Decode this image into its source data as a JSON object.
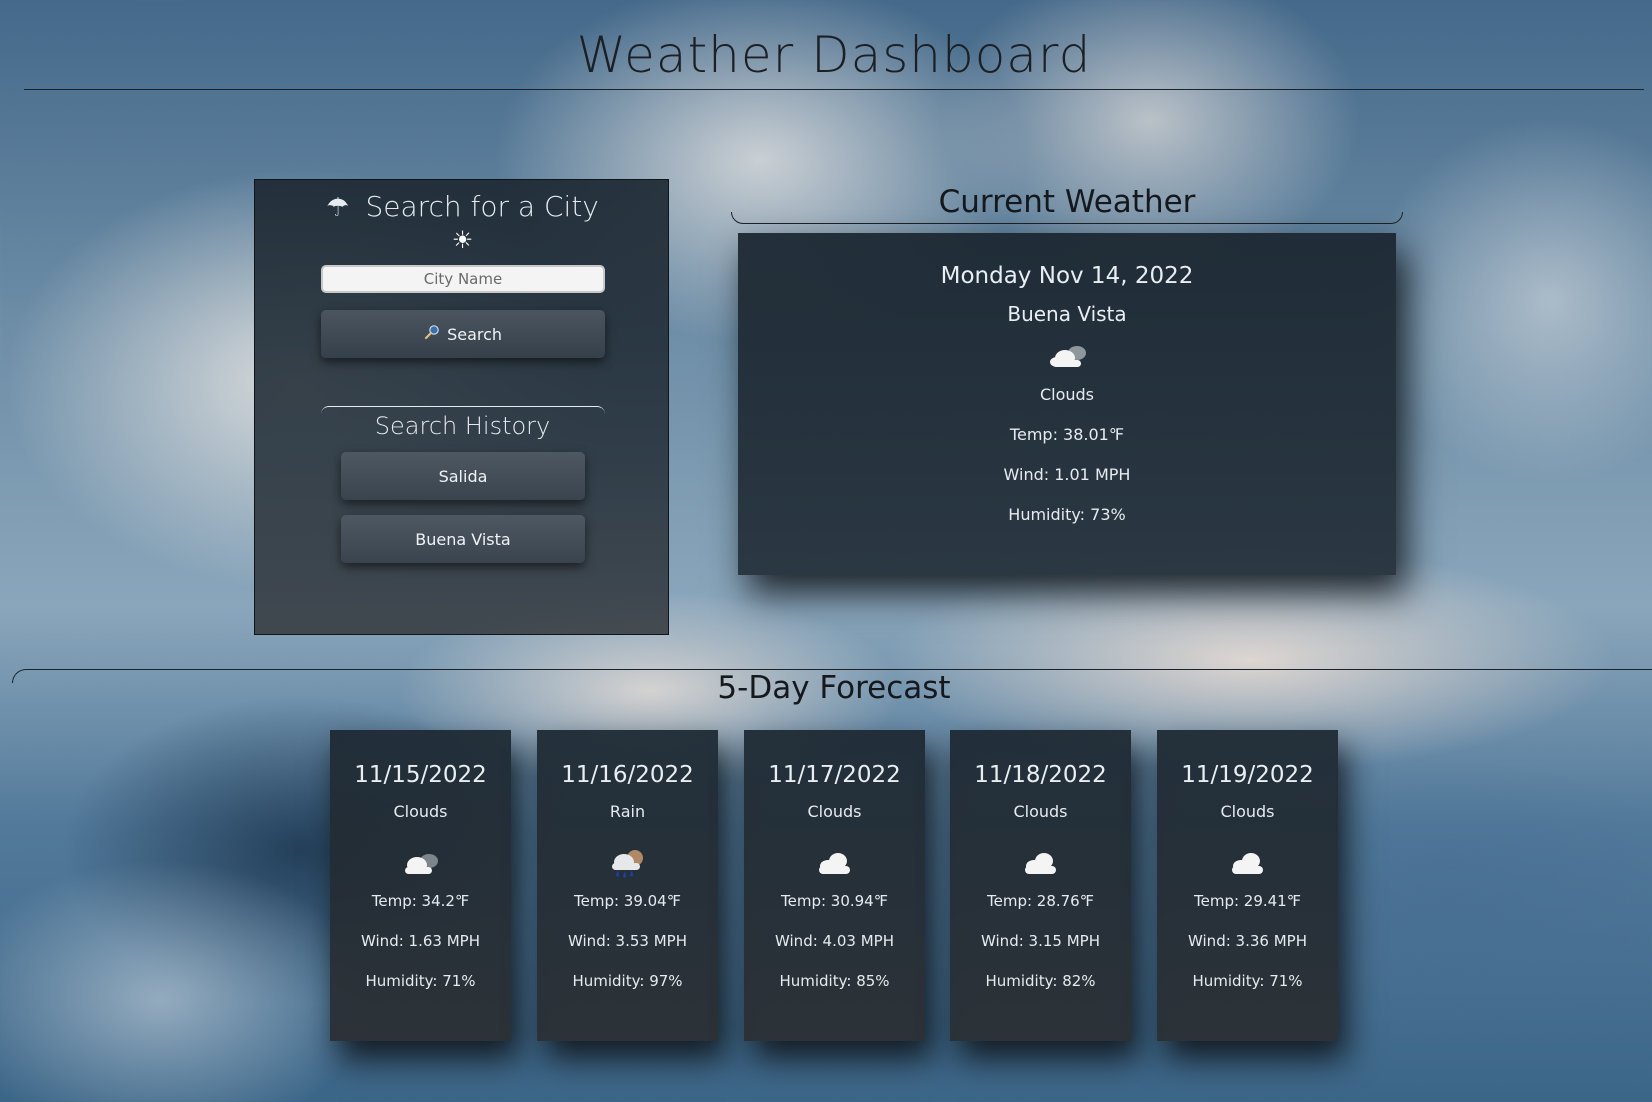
{
  "header": {
    "title": "Weather Dashboard"
  },
  "search": {
    "heading": "Search for a City",
    "umbrella_icon": "umbrella-icon",
    "sun_icon": "sun-icon",
    "placeholder": "City Name",
    "value": "",
    "button_label": "Search",
    "button_icon": "magnifier-icon"
  },
  "history": {
    "heading": "Search History",
    "items": [
      {
        "label": "Salida"
      },
      {
        "label": "Buena Vista"
      }
    ]
  },
  "current": {
    "heading": "Current Weather",
    "date": "Monday Nov 14, 2022",
    "city": "Buena Vista",
    "icon": "cloud-icon",
    "description": "Clouds",
    "temp": "Temp: 38.01℉",
    "wind": "Wind: 1.01 MPH",
    "humidity": "Humidity: 73%"
  },
  "forecast": {
    "heading": "5-Day Forecast",
    "days": [
      {
        "date": "11/15/2022",
        "description": "Clouds",
        "icon": "cloud-dark-icon",
        "temp": "Temp: 34.2℉",
        "wind": "Wind: 1.63 MPH",
        "humidity": "Humidity: 71%"
      },
      {
        "date": "11/16/2022",
        "description": "Rain",
        "icon": "rain-icon",
        "temp": "Temp: 39.04℉",
        "wind": "Wind: 3.53 MPH",
        "humidity": "Humidity: 97%"
      },
      {
        "date": "11/17/2022",
        "description": "Clouds",
        "icon": "cloud-icon",
        "temp": "Temp: 30.94℉",
        "wind": "Wind: 4.03 MPH",
        "humidity": "Humidity: 85%"
      },
      {
        "date": "11/18/2022",
        "description": "Clouds",
        "icon": "cloud-icon",
        "temp": "Temp: 28.76℉",
        "wind": "Wind: 3.15 MPH",
        "humidity": "Humidity: 82%"
      },
      {
        "date": "11/19/2022",
        "description": "Clouds",
        "icon": "cloud-icon",
        "temp": "Temp: 29.41℉",
        "wind": "Wind: 3.36 MPH",
        "humidity": "Humidity: 71%"
      }
    ]
  }
}
